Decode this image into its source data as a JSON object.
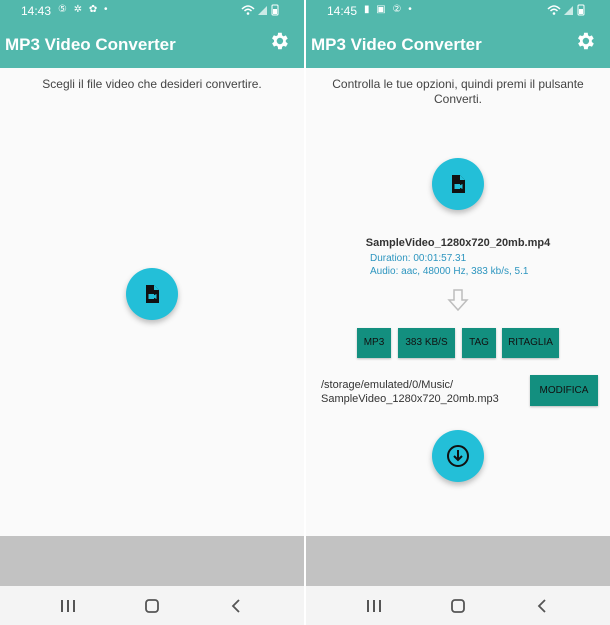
{
  "left": {
    "status_time": "14:43",
    "status_icons": "⑤ ✲ ✿ •",
    "app_title": "MP3 Video Converter",
    "instruction": "Scegli il file video che desideri convertire."
  },
  "right": {
    "status_time": "14:45",
    "status_icons": "▮ ▣ ② •",
    "app_title": "MP3 Video Converter",
    "instruction": "Controlla le tue opzioni, quindi premi il pulsante Converti.",
    "file_name": "SampleVideo_1280x720_20mb.mp4",
    "duration": "Duration: 00:01:57.31",
    "audio": "Audio: aac, 48000 Hz, 383 kb/s,  5.1",
    "options": {
      "format": "MP3",
      "bitrate": "383 KB/S",
      "tag": "TAG",
      "trim": "RITAGLIA"
    },
    "output_path_line1": "/storage/emulated/0/Music/",
    "output_path_line2": "SampleVideo_1280x720_20mb.mp3",
    "edit_button": "MODIFICA"
  },
  "colors": {
    "app_bar": "#52b8ac",
    "fab": "#23bfd8",
    "option_button": "#138f7f",
    "meta_text": "#2c95bf",
    "ad_area": "#c2c2c2"
  },
  "icons": [
    "settings-gear-icon",
    "video-file-icon",
    "down-arrow-icon",
    "download-icon",
    "recent-apps-icon",
    "home-icon",
    "back-icon"
  ]
}
